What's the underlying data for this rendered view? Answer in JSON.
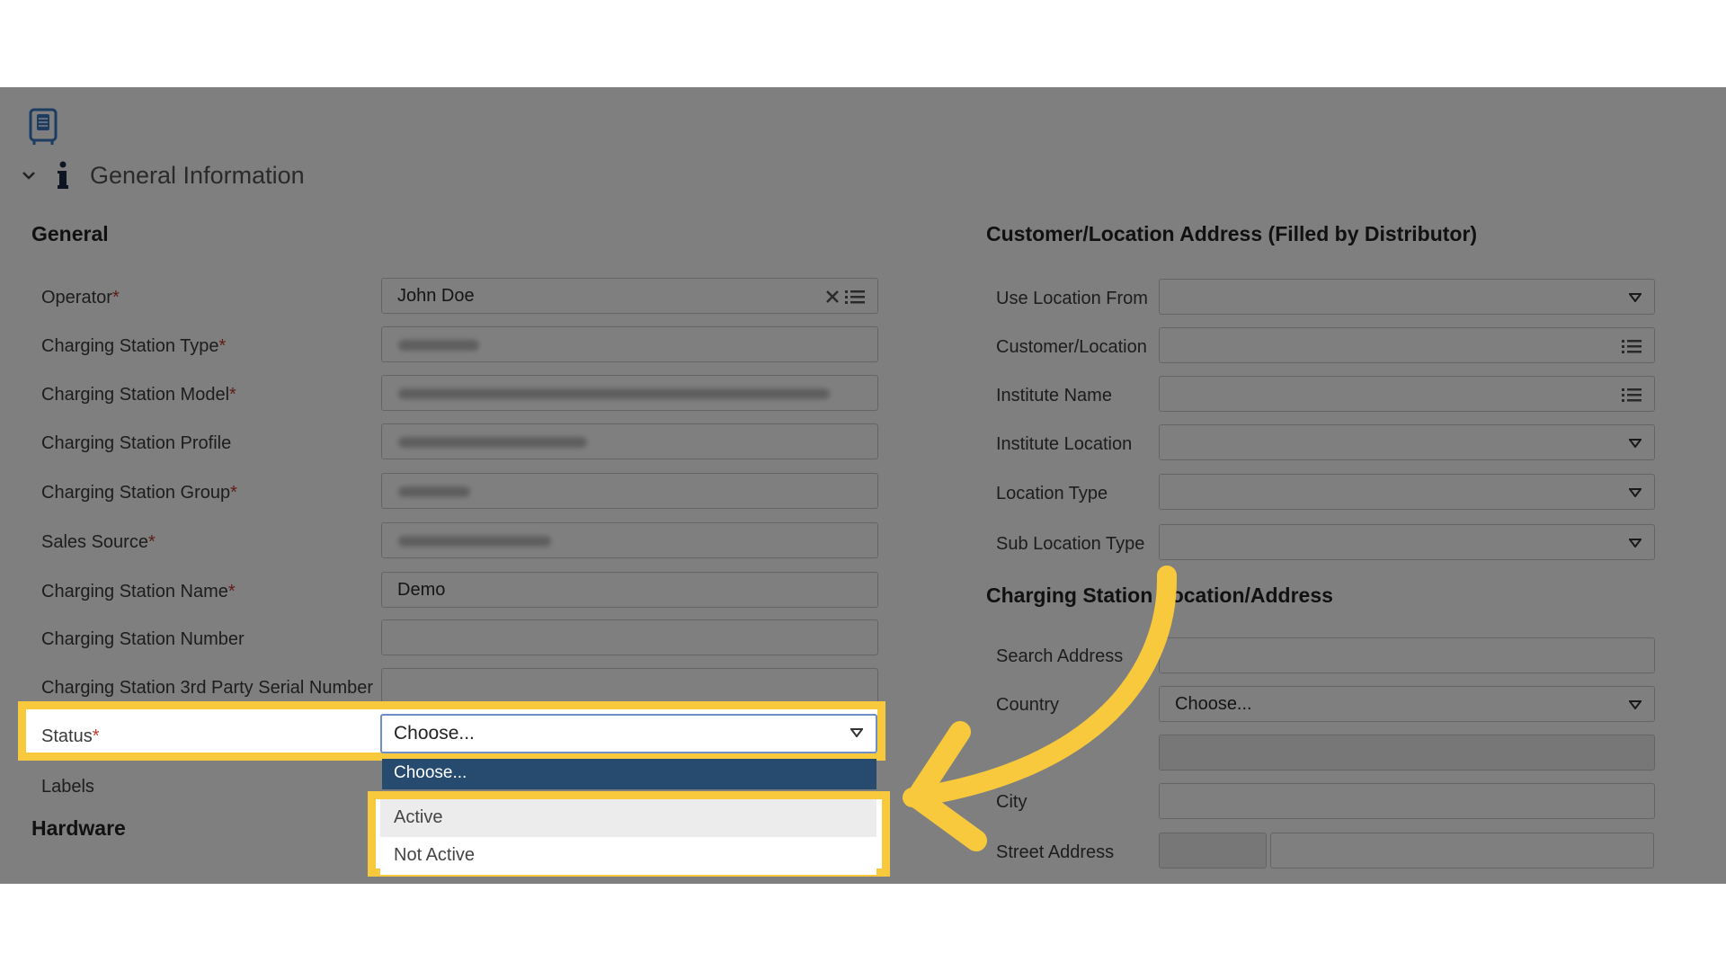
{
  "section": {
    "title": "General Information"
  },
  "general": {
    "heading": "General",
    "labels": {
      "operator": "Operator",
      "station_type": "Charging Station Type",
      "station_model": "Charging Station Model",
      "station_profile": "Charging Station Profile",
      "station_group": "Charging Station Group",
      "sales_source": "Sales Source",
      "station_name": "Charging Station Name",
      "station_number": "Charging Station Number",
      "third_party_serial": "Charging Station 3rd Party Serial Number",
      "status": "Status",
      "labels": "Labels"
    },
    "required_mark": "*",
    "values": {
      "operator": "John Doe",
      "station_name": "Demo",
      "status": "Choose..."
    }
  },
  "status_dropdown": {
    "header": "Choose...",
    "options": [
      "Active",
      "Not Active"
    ]
  },
  "hardware": {
    "heading": "Hardware"
  },
  "customer": {
    "heading": "Customer/Location Address (Filled by Distributor)",
    "labels": {
      "use_location_from": "Use Location From",
      "customer_location": "Customer/Location",
      "institute_name": "Institute Name",
      "institute_location": "Institute Location",
      "location_type": "Location Type",
      "sub_location_type": "Sub Location Type"
    }
  },
  "station_address": {
    "heading": "Charging Station Location/Address",
    "labels": {
      "search_address": "Search Address",
      "country": "Country",
      "city": "City",
      "street_address": "Street Address"
    },
    "values": {
      "country": "Choose..."
    }
  },
  "colors": {
    "highlight": "#f8c93c",
    "dropdown_header": "#274a6f",
    "required": "#c0392b"
  }
}
